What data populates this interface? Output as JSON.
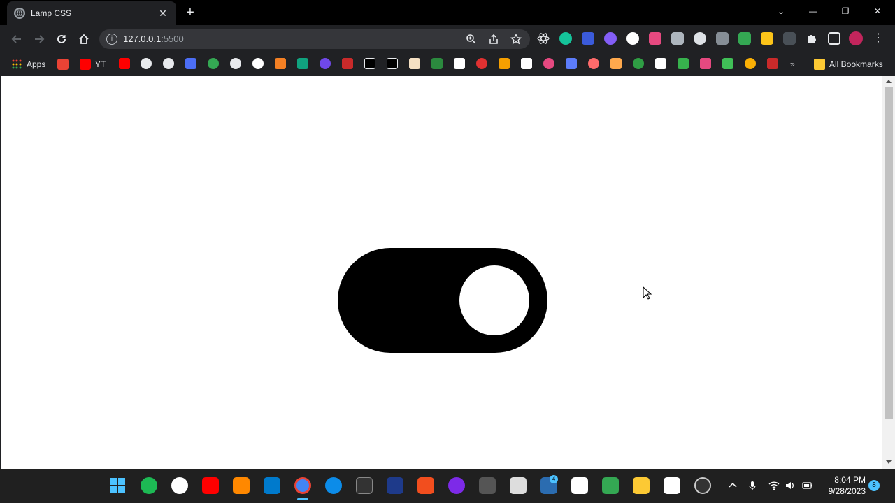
{
  "browser": {
    "tab_title": "Lamp CSS",
    "tab_close": "✕",
    "new_tab": "+",
    "url_host": "127.0.0.1",
    "url_port": ":5500",
    "window_controls": {
      "minimize": "—",
      "restore": "❐",
      "close": "✕",
      "tablist": "⌄"
    }
  },
  "bookmarks": {
    "apps_label": "Apps",
    "yt_label": "YT",
    "more_label": "»",
    "all_label": "All Bookmarks"
  },
  "toggle": {
    "state": "on"
  },
  "taskbar": {
    "time": "8:04 PM",
    "date": "9/28/2023",
    "notifications": "8",
    "badge": "4"
  },
  "colors": {
    "toggle_track": "#000000",
    "toggle_knob": "#ffffff",
    "page_bg": "#ffffff"
  }
}
